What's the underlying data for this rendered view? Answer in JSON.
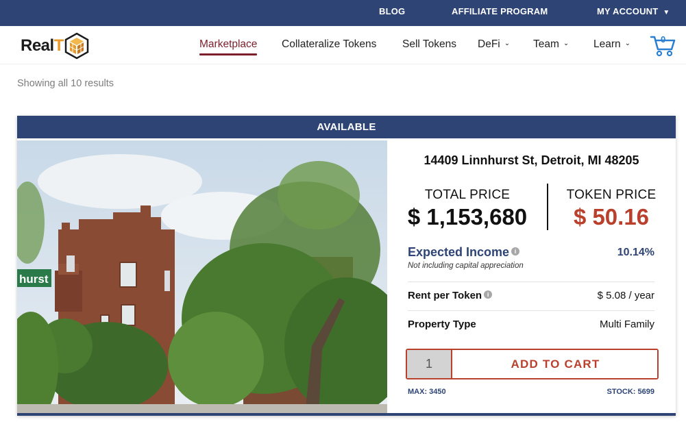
{
  "topbar": {
    "blog": "BLOG",
    "affiliate": "AFFILIATE PROGRAM",
    "account": "MY ACCOUNT"
  },
  "logo": {
    "text_main": "Real",
    "text_accent": "T"
  },
  "nav": {
    "items": [
      {
        "label": "Marketplace",
        "active": true
      },
      {
        "label": "Collateralize Tokens"
      },
      {
        "label": "Sell Tokens"
      },
      {
        "label": "DeFi",
        "dropdown": true
      },
      {
        "label": "Team",
        "dropdown": true
      },
      {
        "label": "Learn",
        "dropdown": true
      }
    ],
    "cart_count": "0"
  },
  "results_text": "Showing all 10 results",
  "product": {
    "status": "AVAILABLE",
    "address": "14409 Linnhurst St, Detroit, MI 48205",
    "street_sign": "hurst",
    "total_price_label": "TOTAL PRICE",
    "total_price": "$ 1,153,680",
    "token_price_label": "TOKEN PRICE",
    "token_price": "$ 50.16",
    "expected_income_label": "Expected Income",
    "expected_income_note": "Not including capital appreciation",
    "expected_income_value": "10.14%",
    "rent_label": "Rent per Token",
    "rent_value": "$ 5.08 / year",
    "type_label": "Property Type",
    "type_value": "Multi Family",
    "quantity": "1",
    "add_to_cart": "ADD TO CART",
    "max": "MAX: 3450",
    "stock": "STOCK: 5699"
  },
  "colors": {
    "navy": "#2d4475",
    "accent_red": "#b8402d",
    "active_nav": "#7a1f2b",
    "logo_orange": "#e89b2a"
  }
}
